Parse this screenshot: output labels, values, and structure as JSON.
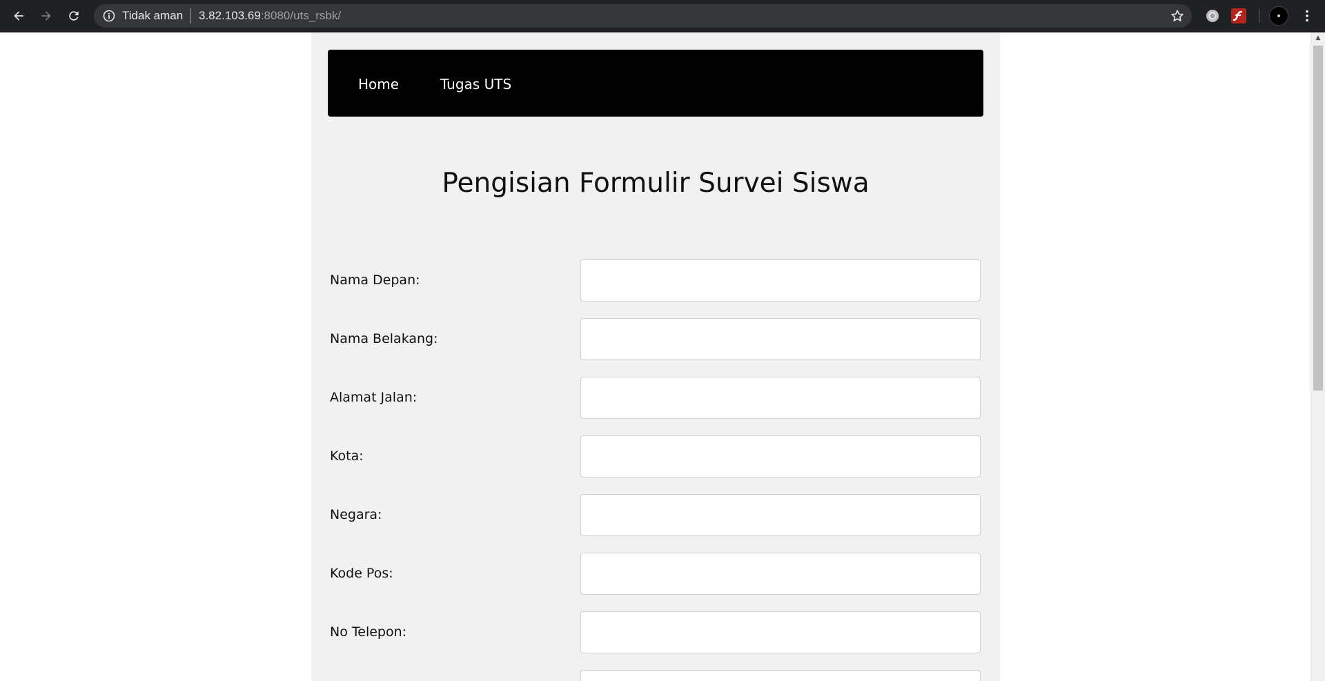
{
  "browser": {
    "security_text": "Tidak aman",
    "url_host": "3.82.103.69",
    "url_rest": ":8080/uts_rsbk/",
    "icons": [
      "back-arrow-icon",
      "forward-arrow-icon",
      "reload-icon",
      "info-icon",
      "star-icon",
      "extension-icon",
      "flash-icon",
      "menu-dots-icon"
    ]
  },
  "navbar": {
    "items": [
      {
        "label": "Home"
      },
      {
        "label": "Tugas UTS"
      }
    ]
  },
  "page": {
    "title": "Pengisian Formulir Survei Siswa"
  },
  "form": {
    "fields": [
      {
        "label": "Nama Depan:",
        "value": ""
      },
      {
        "label": "Nama Belakang:",
        "value": ""
      },
      {
        "label": "Alamat Jalan:",
        "value": ""
      },
      {
        "label": "Kota:",
        "value": ""
      },
      {
        "label": "Negara:",
        "value": ""
      },
      {
        "label": "Kode Pos:",
        "value": ""
      },
      {
        "label": "No Telepon:",
        "value": ""
      },
      {
        "label": "",
        "value": ""
      }
    ]
  },
  "colors": {
    "navbar_bg": "#000000",
    "page_bg": "#f1f1f1",
    "chrome_bg": "#202124"
  }
}
